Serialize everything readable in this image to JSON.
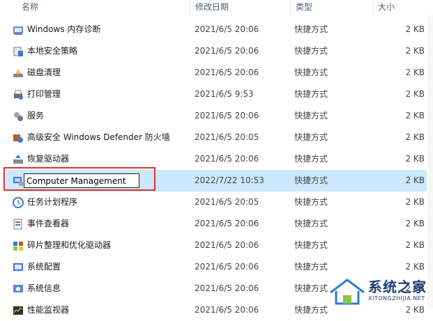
{
  "columns": {
    "name": "名称",
    "date": "修改日期",
    "type": "类型",
    "size": "大小"
  },
  "rows": [
    {
      "name": "Windows 内存诊断",
      "date": "2021/6/5 20:06",
      "type": "快捷方式",
      "size": "2 KB",
      "icon": "memory-diagnostic-icon",
      "selected": false
    },
    {
      "name": "本地安全策略",
      "date": "2021/6/5 20:06",
      "type": "快捷方式",
      "size": "2 KB",
      "icon": "security-policy-icon",
      "selected": false
    },
    {
      "name": "磁盘清理",
      "date": "2021/6/5 20:06",
      "type": "快捷方式",
      "size": "2 KB",
      "icon": "disk-cleanup-icon",
      "selected": false
    },
    {
      "name": "打印管理",
      "date": "2021/6/5 9:53",
      "type": "快捷方式",
      "size": "2 KB",
      "icon": "print-management-icon",
      "selected": false
    },
    {
      "name": "服务",
      "date": "2021/6/5 20:06",
      "type": "快捷方式",
      "size": "2 KB",
      "icon": "services-icon",
      "selected": false
    },
    {
      "name": "高级安全 Windows Defender 防火墙",
      "date": "2021/6/5 20:05",
      "type": "快捷方式",
      "size": "2 KB",
      "icon": "firewall-icon",
      "selected": false
    },
    {
      "name": "恢复驱动器",
      "date": "2021/6/5 20:06",
      "type": "快捷方式",
      "size": "2 KB",
      "icon": "recovery-drive-icon",
      "selected": false
    },
    {
      "name": "Computer Management",
      "date": "2022/7/22 10:53",
      "type": "快捷方式",
      "size": "2 KB",
      "icon": "computer-management-icon",
      "selected": true
    },
    {
      "name": "任务计划程序",
      "date": "2021/6/5 20:05",
      "type": "快捷方式",
      "size": "2 KB",
      "icon": "task-scheduler-icon",
      "selected": false
    },
    {
      "name": "事件查看器",
      "date": "2021/6/5 20:06",
      "type": "快捷方式",
      "size": "2 KB",
      "icon": "event-viewer-icon",
      "selected": false
    },
    {
      "name": "碎片整理和优化驱动器",
      "date": "2021/6/5 20:06",
      "type": "快捷方式",
      "size": "2 KB",
      "icon": "defrag-icon",
      "selected": false
    },
    {
      "name": "系统配置",
      "date": "2021/6/5 20:06",
      "type": "快捷方式",
      "size": "2 KB",
      "icon": "system-config-icon",
      "selected": false
    },
    {
      "name": "系统信息",
      "date": "2021/6/5 20:06",
      "type": "快捷方式",
      "size": "2 KB",
      "icon": "system-info-icon",
      "selected": false
    },
    {
      "name": "性能监视器",
      "date": "2021/6/5 20:06",
      "type": "快捷方式",
      "size": "2 KB",
      "icon": "performance-monitor-icon",
      "selected": false
    }
  ],
  "rename_value": "Computer Management",
  "watermark": {
    "main": "系统之家",
    "sub": "XITONGZHIJIA.NET"
  },
  "colors": {
    "selection": "#cce8ff",
    "highlight_border": "#e03131",
    "header_text": "#4c607a"
  }
}
